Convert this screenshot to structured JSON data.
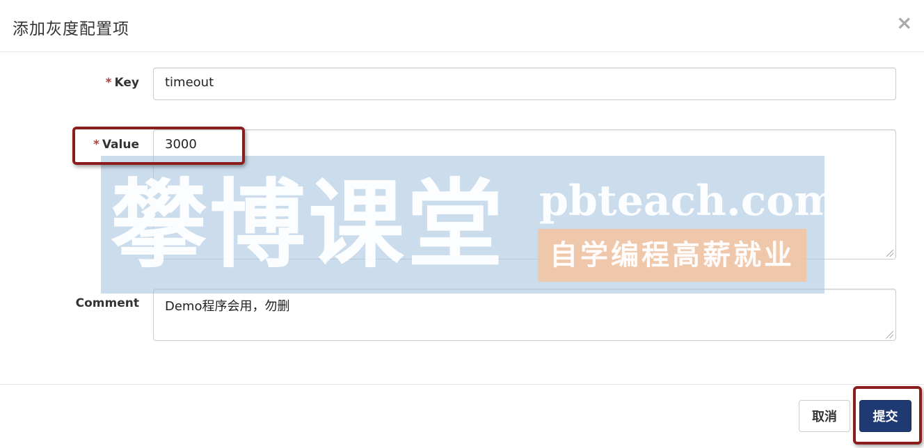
{
  "dialog": {
    "title": "添加灰度配置项",
    "close_icon": "×"
  },
  "form": {
    "required_mark": "*",
    "key": {
      "label": "Key",
      "value": "timeout"
    },
    "value": {
      "label": "Value",
      "value": "3000"
    },
    "comment": {
      "label": "Comment",
      "value": "Demo程序会用，勿删"
    }
  },
  "footer": {
    "cancel_label": "取消",
    "submit_label": "提交"
  },
  "watermark": {
    "brand": "攀博课堂",
    "url": "pbteach.com",
    "slogan": "自学编程高薪就业"
  },
  "colors": {
    "primary_button": "#1f3a73",
    "highlight_border": "#8b1d1d",
    "required_asterisk": "#a94442"
  }
}
